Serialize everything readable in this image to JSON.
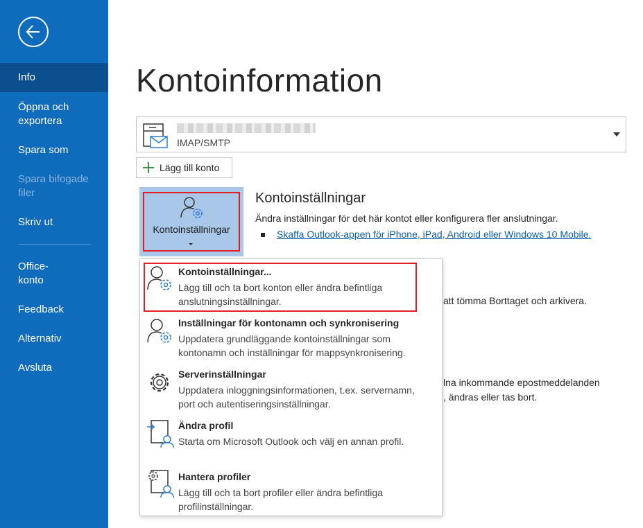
{
  "sidebar": {
    "back_icon": "back-arrow-icon",
    "items": [
      {
        "label": "Info"
      },
      {
        "label": "Öppna och exportera"
      },
      {
        "label": "Spara som"
      },
      {
        "label": "Spara bifogade filer"
      },
      {
        "label": "Skriv ut"
      },
      {
        "label": "Office-konto"
      },
      {
        "label": "Feedback"
      },
      {
        "label": "Alternativ"
      },
      {
        "label": "Avsluta"
      }
    ]
  },
  "page": {
    "title": "Kontoinformation"
  },
  "account": {
    "type": "IMAP/SMTP",
    "icon": "mailbox-icon"
  },
  "add_account": {
    "label": "Lägg till konto"
  },
  "account_settings_button": {
    "label": "Kontoinställningar"
  },
  "account_settings_section": {
    "title": "Kontoinställningar",
    "description": "Ändra inställningar för det här kontot eller konfigurera fler anslutningar.",
    "link": "Skaffa Outlook-appen för iPhone, iPad, Android eller Windows 10 Mobile."
  },
  "background_text": {
    "line1": "att tömma Borttaget och arkivera.",
    "line2": "lna inkommande epostmeddelanden",
    "line3": ", ändras eller tas bort."
  },
  "menu": {
    "items": [
      {
        "title": "Kontoinställningar...",
        "desc": "Lägg till och ta bort konton eller ändra befintliga anslutningsinställningar.",
        "icon": "account-settings-icon"
      },
      {
        "title": "Inställningar för kontonamn och synkronisering",
        "desc": "Uppdatera grundläggande kontoinställningar som kontonamn och inställningar för mappsynkronisering.",
        "icon": "account-sync-icon"
      },
      {
        "title": "Serverinställningar",
        "desc": "Uppdatera inloggningsinformationen, t.ex. servernamn, port och autentiseringsinställningar.",
        "icon": "gear-icon"
      },
      {
        "title": "Ändra profil",
        "desc": "Starta om Microsoft Outlook och välj en annan profil.",
        "icon": "change-profile-icon"
      },
      {
        "title": "Hantera profiler",
        "desc": "Lägg till och ta bort profiler eller ändra befintliga profilinställningar.",
        "icon": "manage-profiles-icon"
      }
    ]
  },
  "colors": {
    "sidebar": "#0f6cbd",
    "sidebar_active": "#0b4f8f",
    "accent_blue": "#2b7cd3",
    "highlight_red": "#e02020",
    "button_bg": "#a9c7e8"
  }
}
